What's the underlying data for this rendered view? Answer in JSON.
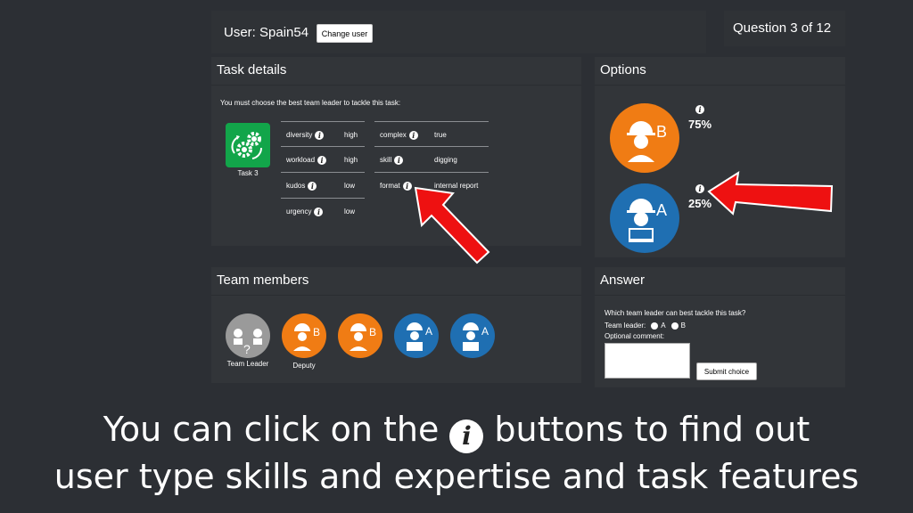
{
  "user": {
    "label": "User: Spain54",
    "change_button": "Change user"
  },
  "question": {
    "label": "Question 3 of 12"
  },
  "task_details": {
    "title": "Task details",
    "instruction": "You must choose the best team leader to tackle this task:",
    "task_name": "Task 3",
    "features_left": [
      {
        "name": "diversity",
        "value": "high"
      },
      {
        "name": "workload",
        "value": "high"
      },
      {
        "name": "kudos",
        "value": "low"
      },
      {
        "name": "urgency",
        "value": "low"
      }
    ],
    "features_right": [
      {
        "name": "complex",
        "value": "true"
      },
      {
        "name": "skill",
        "value": "digging"
      },
      {
        "name": "format",
        "value": "internal report"
      }
    ]
  },
  "options": {
    "title": "Options",
    "items": [
      {
        "letter": "B",
        "percent": "75%",
        "color": "#f07c14"
      },
      {
        "letter": "A",
        "percent": "25%",
        "color": "#1f6fb2"
      }
    ]
  },
  "team": {
    "title": "Team members",
    "leader_label": "Team Leader",
    "deputy_label": "Deputy",
    "members": [
      {
        "letter": "?",
        "color": "#9a9a9a"
      },
      {
        "letter": "B",
        "color": "#f07c14"
      },
      {
        "letter": "B",
        "color": "#f07c14"
      },
      {
        "letter": "A",
        "color": "#1f6fb2"
      },
      {
        "letter": "A",
        "color": "#1f6fb2"
      }
    ]
  },
  "answer": {
    "title": "Answer",
    "question": "Which team leader can best tackle this task?",
    "leader_label": "Team leader:",
    "option_a": "A",
    "option_b": "B",
    "comment_label": "Optional comment:",
    "submit": "Submit choice"
  },
  "caption": {
    "line1_pre": "You can click on the",
    "line1_post": "buttons to find out",
    "line2": "user type skills and expertise and task features",
    "info_glyph": "i"
  },
  "colors": {
    "arrow": "#ee1111",
    "task_icon": "#12a54a"
  }
}
